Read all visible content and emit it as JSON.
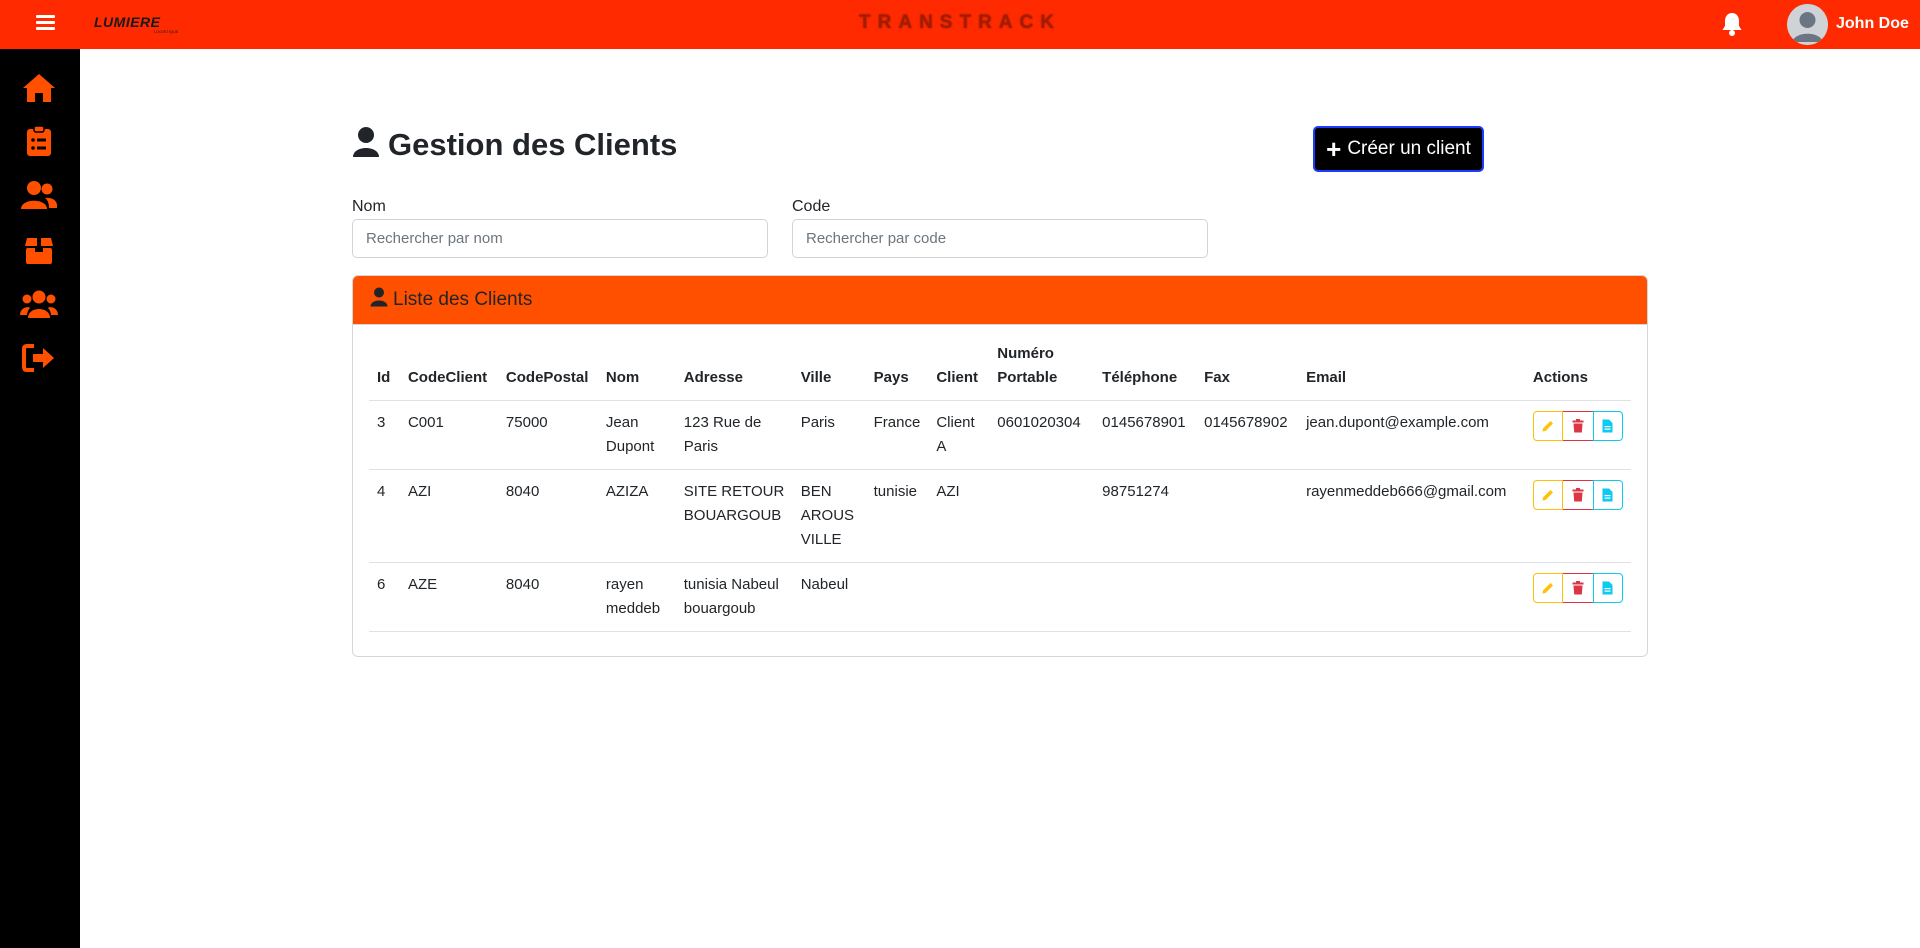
{
  "header": {
    "logo_text": "LUMIERE",
    "logo_sub": "LOGISTIQUE",
    "brand": "TRANSTRACK",
    "user_name": "John Doe"
  },
  "sidebar": {
    "items": [
      {
        "icon": "home-icon"
      },
      {
        "icon": "clipboard-list-icon"
      },
      {
        "icon": "users-icon"
      },
      {
        "icon": "box-icon"
      },
      {
        "icon": "group-icon"
      },
      {
        "icon": "logout-icon"
      }
    ]
  },
  "page": {
    "title": "Gestion des Clients",
    "create_button": "Créer un client"
  },
  "filters": {
    "nom_label": "Nom",
    "nom_placeholder": "Rechercher par nom",
    "code_label": "Code",
    "code_placeholder": "Rechercher par code"
  },
  "card": {
    "title": "Liste des Clients"
  },
  "table": {
    "headers": [
      "Id",
      "CodeClient",
      "CodePostal",
      "Nom",
      "Adresse",
      "Ville",
      "Pays",
      "Client",
      "Numéro Portable",
      "Téléphone",
      "Fax",
      "Email",
      "Actions"
    ],
    "rows": [
      [
        "3",
        "C001",
        "75000",
        "Jean Dupont",
        "123 Rue de Paris",
        "Paris",
        "France",
        "Client A",
        "0601020304",
        "0145678901",
        "0145678902",
        "jean.dupont@example.com"
      ],
      [
        "4",
        "AZI",
        "8040",
        "AZIZA",
        "SITE RETOUR BOUARGOUB",
        "BEN AROUS VILLE",
        "tunisie",
        "AZI",
        "",
        "98751274",
        "",
        "rayenmeddeb666@gmail.com"
      ],
      [
        "6",
        "AZE",
        "8040",
        "rayen meddeb",
        "tunisia Nabeul bouargoub",
        "Nabeul",
        "",
        "",
        "",
        "",
        "",
        ""
      ]
    ]
  },
  "colors": {
    "topbar": "#ff2a00",
    "card_header": "#ff5000",
    "sidebar_icons": "#ff5000",
    "edit": "#ffc107",
    "delete": "#dc3545",
    "details": "#0dcaf0"
  }
}
